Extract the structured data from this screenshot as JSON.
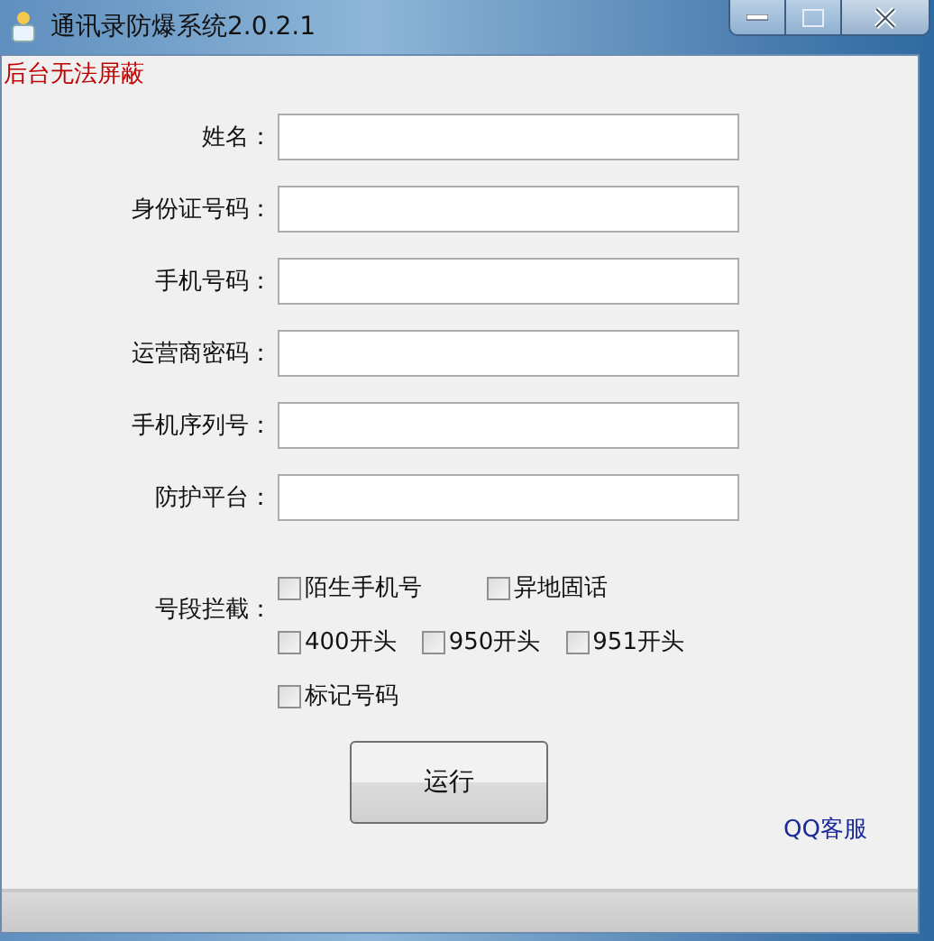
{
  "window": {
    "title": "通讯录防爆系统2.0.2.1"
  },
  "notice": "后台无法屏蔽",
  "fields": [
    {
      "label": "姓名："
    },
    {
      "label": "身份证号码："
    },
    {
      "label": "手机号码："
    },
    {
      "label": "运营商密码："
    },
    {
      "label": "手机序列号："
    },
    {
      "label": "防护平台："
    }
  ],
  "blocking": {
    "label": "号段拦截：",
    "rows": [
      [
        {
          "label": "陌生手机号",
          "checked": false
        },
        {
          "label": "异地固话",
          "checked": false
        }
      ],
      [
        {
          "label": "400开头",
          "checked": false
        },
        {
          "label": "950开头",
          "checked": false
        },
        {
          "label": "951开头",
          "checked": false
        }
      ],
      [
        {
          "label": "标记号码",
          "checked": false
        }
      ]
    ]
  },
  "run_button": "运行",
  "support_link": "QQ客服"
}
